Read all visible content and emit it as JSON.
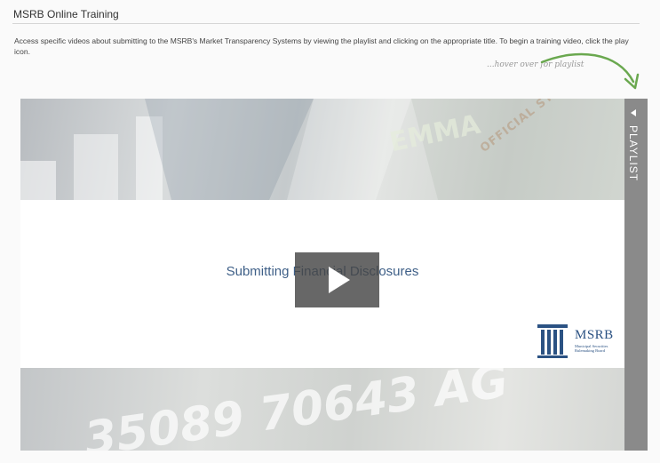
{
  "header": {
    "title": "MSRB Online Training"
  },
  "intro": {
    "text": "Access specific videos about submitting to the MSRB's Market Transparency Systems by viewing the playlist and clicking on the appropriate title. To begin a training video, click the play icon."
  },
  "hint": {
    "text": "...hover over for playlist"
  },
  "player": {
    "slide_title": "Submitting Financial Disclosures",
    "playlist_label": "PLAYLIST",
    "logo": {
      "name": "MSRB",
      "subtitle": "Municipal Securities Rulemaking Board"
    },
    "banner_top_text": "OFFICIAL STATEMENTS AND",
    "banner_top_text2": "EMMA",
    "banner_bottom_text": "35089 70643 AG"
  },
  "colors": {
    "accent_blue": "#2b5283",
    "accent_green": "#5b9b3c",
    "hint_arrow": "#6aa84f",
    "playlist_tab": "#8a8a8a"
  },
  "icons": {
    "play": "play-icon",
    "playlist_toggle": "triangle-left-icon",
    "logo_mark": "columns-icon",
    "hint_arrow": "curved-arrow-icon"
  }
}
